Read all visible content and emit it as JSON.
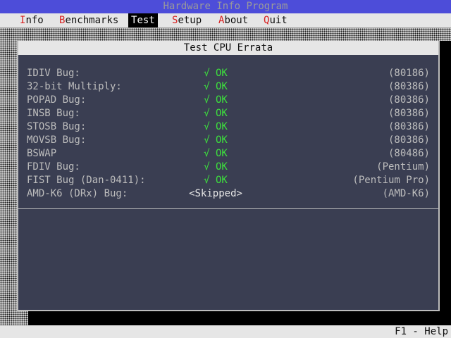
{
  "app": {
    "title": "Hardware Info Program"
  },
  "menu": [
    {
      "hot": "I",
      "rest": "nfo",
      "active": false
    },
    {
      "hot": "B",
      "rest": "enchmarks",
      "active": false
    },
    {
      "hot": "T",
      "rest": "est",
      "active": true
    },
    {
      "hot": "S",
      "rest": "etup",
      "active": false
    },
    {
      "hot": "A",
      "rest": "bout",
      "active": false
    },
    {
      "hot": "Q",
      "rest": "uit",
      "active": false
    }
  ],
  "window": {
    "title": "Test CPU Errata",
    "rows": [
      {
        "name": "IDIV Bug:",
        "status": "√ OK",
        "type": "ok",
        "cpu": "(80186)"
      },
      {
        "name": "32-bit Multiply:",
        "status": "√ OK",
        "type": "ok",
        "cpu": "(80386)"
      },
      {
        "name": "POPAD Bug:",
        "status": "√ OK",
        "type": "ok",
        "cpu": "(80386)"
      },
      {
        "name": "INSB Bug:",
        "status": "√ OK",
        "type": "ok",
        "cpu": "(80386)"
      },
      {
        "name": "STOSB Bug:",
        "status": "√ OK",
        "type": "ok",
        "cpu": "(80386)"
      },
      {
        "name": "MOVSB Bug:",
        "status": "√ OK",
        "type": "ok",
        "cpu": "(80386)"
      },
      {
        "name": "BSWAP",
        "status": "√ OK",
        "type": "ok",
        "cpu": "(80486)"
      },
      {
        "name": "FDIV Bug:",
        "status": "√ OK",
        "type": "ok",
        "cpu": "(Pentium)"
      },
      {
        "name": "FIST Bug (Dan-0411):",
        "status": "√ OK",
        "type": "ok",
        "cpu": "(Pentium Pro)"
      },
      {
        "name": "AMD-K6 (DRx) Bug:",
        "status": "<Skipped>",
        "type": "skipped",
        "cpu": "(AMD-K6)"
      }
    ]
  },
  "statusbar": {
    "help": "F1 - Help"
  },
  "colors": {
    "titlebar": "#4d4dd9",
    "panel": "#3a3e52",
    "ok": "#3de03d",
    "hotkey": "#d82020"
  }
}
